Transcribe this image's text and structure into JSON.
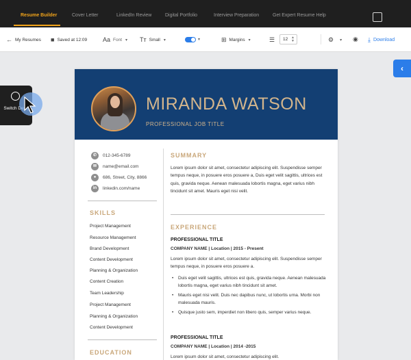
{
  "nav": {
    "tabs": [
      "Resume Builder",
      "Cover Letter",
      "LinkedIn Review",
      "Digital Portfolio",
      "Interview Preparation",
      "Get Expert Resume Help"
    ]
  },
  "toolbar": {
    "back_label": "My Resumes",
    "saved_label": "Saved at 12:09",
    "font_label": "Font",
    "size_label": "Small",
    "margins_label": "Margins",
    "line_spacing_value": "12",
    "download_label": "Download"
  },
  "switch_design": {
    "label": "Switch Design"
  },
  "resume": {
    "name": "MIRANDA WATSON",
    "job_title": "PROFESSIONAL JOB TITLE",
    "contact": {
      "phone": "012-345-6789",
      "email": "name@email.com",
      "address": "686, Street, City, 8866",
      "linkedin": "linkedin.com/name"
    },
    "skills_heading": "SKILLS",
    "skills": [
      "Project Management",
      "Resource Management",
      "Brand Development",
      "Content Development",
      "Planning & Organization",
      "Content Creation",
      "Team Leadership",
      "Project Management",
      "Planning & Organization",
      "Content Development"
    ],
    "education_heading": "EDUCATION",
    "summary_heading": "SUMMARY",
    "summary": "Lorem ipsum dolor sit amet, consectetur adipiscing elit. Suspendisse semper tempus neque, in posuere eros posuere a, Duis eget velit sagittis, ultrices est quis, gravida neque. Aenean malesuada lobortis magna, eget varius nibh tincidunt sit amet. Mauris eget nisi velit.",
    "experience_heading": "EXPERIENCE",
    "jobs": [
      {
        "title": "PROFESSIONAL TITLE",
        "company": "COMPANY NAME | Location | 2015 - Present",
        "description": "Lorem ipsum dolor sit amet, consectetur adipiscing elit. Suspendisse semper tempus neque, in posuere eros posuere a.",
        "bullets": [
          "Duis eget velit sagittis, ultrices est quis, gravida neque. Aenean malesuada lobortis magna, eget varius nibh tincidunt sit amet.",
          "Mauris eget nisi velit. Duis nec dapibus nunc, ut lobortis urna. Morbi non malesuada mauris.",
          "Quisque justo sem, imperdiet non libero quis, semper varius neque."
        ]
      },
      {
        "title": "PROFESSIONAL TITLE",
        "company": "COMPANY NAME | Location | 2014 -2015",
        "description": "Lorem ipsum dolor sit amet, consectetur adipiscing elit."
      }
    ]
  },
  "colors": {
    "header_bg": "#133f73",
    "accent_gold": "#d3b58c",
    "nav_active": "#f2a41a",
    "primary_blue": "#2b7de9"
  }
}
